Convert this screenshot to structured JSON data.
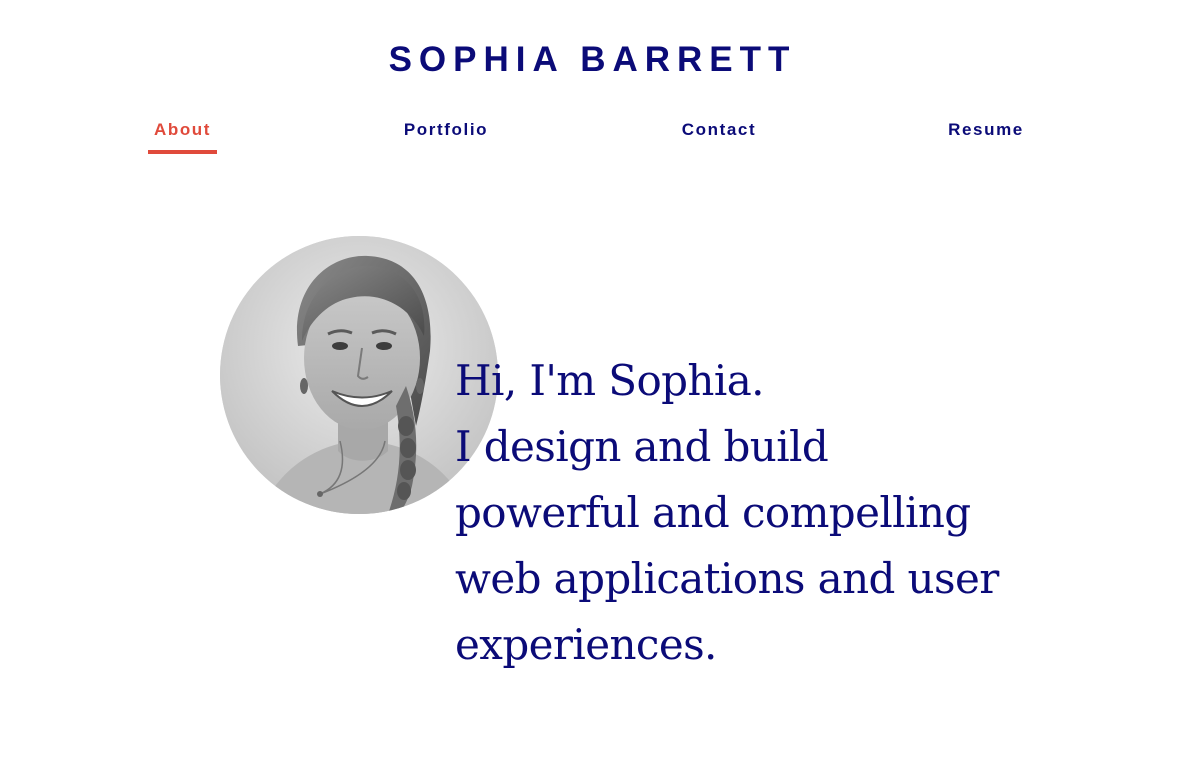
{
  "site": {
    "title": "SOPHIA BARRETT"
  },
  "nav": {
    "items": [
      {
        "label": "About",
        "active": true
      },
      {
        "label": "Portfolio",
        "active": false
      },
      {
        "label": "Contact",
        "active": false
      },
      {
        "label": "Resume",
        "active": false
      }
    ]
  },
  "hero": {
    "greeting": "Hi, I'm Sophia.",
    "tagline": "I design and build powerful and compelling web applications and user experiences.",
    "avatar_icon": "profile-photo"
  },
  "colors": {
    "primary": "#0b0b78",
    "accent": "#e04a3b",
    "background": "#ffffff"
  }
}
